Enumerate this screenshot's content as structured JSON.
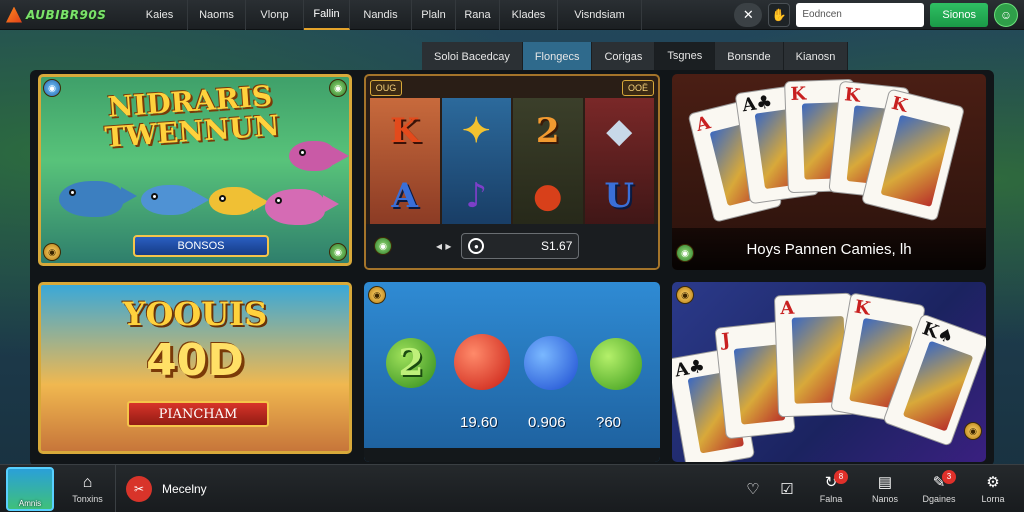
{
  "brand": {
    "name": "AUBIBR90S",
    "accent": "#7be36a"
  },
  "topnav": {
    "items": [
      {
        "label": "Kaies",
        "active": false
      },
      {
        "label": "Naoms",
        "active": false
      },
      {
        "label": "Vlonp",
        "active": false
      },
      {
        "label": "Fallin",
        "active": true
      },
      {
        "label": "Nandis",
        "active": false
      },
      {
        "label": "Plaln",
        "active": false
      },
      {
        "label": "Rana",
        "active": false
      },
      {
        "label": "Klades",
        "active": false
      },
      {
        "label": "Visndsiam",
        "active": false
      }
    ],
    "tools_icon": "tools-icon",
    "hand_icon": "hand-icon",
    "search_placeholder": "Eodncen",
    "primary_button": "Sionos",
    "user_icon": "user-icon"
  },
  "tabs": [
    {
      "label": "Soloi Bacedcay"
    },
    {
      "label": "Flongecs"
    },
    {
      "label": "Corigas"
    },
    {
      "label": "Tsgnes"
    },
    {
      "label": "Bonsnde"
    },
    {
      "label": "Kianosn"
    }
  ],
  "tiles": {
    "fish": {
      "title": "NIDRARIS TWENNUN",
      "button": "BONSOS"
    },
    "slots": {
      "badge_left": "OUG",
      "badge_right": "ООЁ",
      "reels": [
        [
          "K",
          "A"
        ],
        [
          "✦",
          "♪"
        ],
        [
          "2",
          "●"
        ],
        [
          "◆",
          "U"
        ]
      ],
      "arrows": "◂ ▸",
      "amount": "S1.67"
    },
    "cards": {
      "caption": "Hoys Pannen Camies, lh"
    },
    "bonus": {
      "title": "YOOUIS",
      "number": "40D",
      "ribbon": "PIANCHAM"
    },
    "fruits": {
      "values": [
        "19.60",
        "0.906",
        "?60"
      ],
      "symbols": [
        "2",
        "",
        "",
        ""
      ]
    },
    "cards2": {
      "caption": ""
    }
  },
  "bottombar": {
    "thumb_label": "Amnis",
    "home_label": "Tonxins",
    "account_name": "Mecelny",
    "items": [
      {
        "label": "",
        "icon": "heart-icon"
      },
      {
        "label": "",
        "icon": "checklist-icon"
      },
      {
        "label": "Falna",
        "icon": "cycle-icon",
        "badge": "8"
      },
      {
        "label": "Nanos",
        "icon": "document-icon"
      },
      {
        "label": "Dgaines",
        "icon": "chat-icon",
        "badge": "3"
      },
      {
        "label": "Lorna",
        "icon": "gear-icon"
      }
    ]
  },
  "pagination": {
    "count": 3
  }
}
